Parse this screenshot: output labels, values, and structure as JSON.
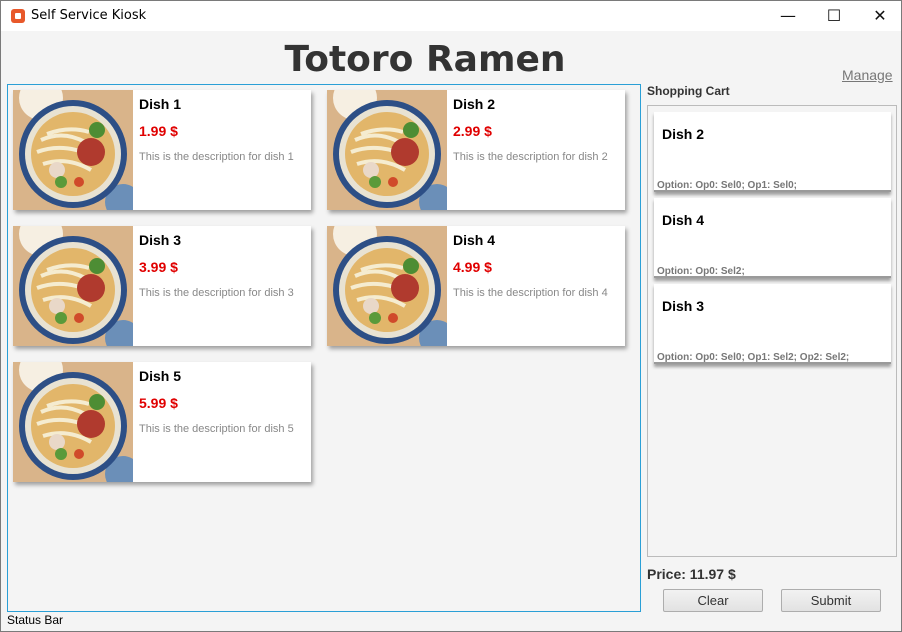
{
  "window": {
    "title": "Self Service Kiosk",
    "icon": "app-icon",
    "controls": {
      "minimize": "—",
      "maximize": "☐",
      "close": "✕"
    }
  },
  "header": {
    "title": "Totoro Ramen",
    "manage_link": "Manage"
  },
  "menu": {
    "dishes": [
      {
        "name": "Dish 1",
        "price": "1.99 $",
        "description": "This is the description for dish 1",
        "image": "ramen-bowl-image"
      },
      {
        "name": "Dish 2",
        "price": "2.99 $",
        "description": "This is the description for dish 2",
        "image": "ramen-bowl-image"
      },
      {
        "name": "Dish 3",
        "price": "3.99 $",
        "description": "This is the description for dish 3",
        "image": "ramen-bowl-image"
      },
      {
        "name": "Dish 4",
        "price": "4.99 $",
        "description": "This is the description for dish 4",
        "image": "ramen-bowl-image"
      },
      {
        "name": "Dish 5",
        "price": "5.99 $",
        "description": "This is the description for dish 5",
        "image": "ramen-bowl-image"
      }
    ]
  },
  "cart": {
    "label": "Shopping Cart",
    "items": [
      {
        "name": "Dish 2",
        "options": "Option: Op0: Sel0; Op1: Sel0;"
      },
      {
        "name": "Dish 4",
        "options": "Option: Op0: Sel2;"
      },
      {
        "name": "Dish 3",
        "options": "Option: Op0: Sel0; Op1: Sel2; Op2: Sel2;"
      }
    ],
    "price": "Price: 11.97 $",
    "clear_label": "Clear",
    "submit_label": "Submit"
  },
  "status_bar": "Status Bar",
  "colors": {
    "accent_border": "#2a9fd6",
    "price_red": "#e00000"
  }
}
